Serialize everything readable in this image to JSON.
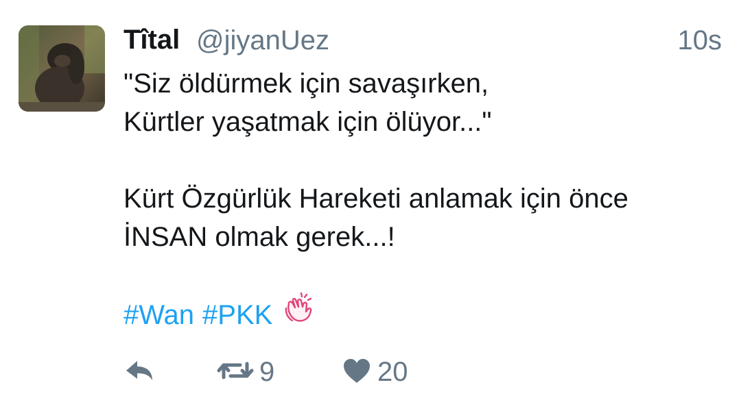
{
  "tweet": {
    "author_name": "Tîtal",
    "author_handle": "@jiyanUez",
    "timestamp": "10s",
    "text_lines": [
      "\"Siz öldürmek için savaşırken,",
      "Kürtler yaşatmak için ölüyor...\"",
      "Kürt Özgürlük Hareketi anlamak için önce",
      "İNSAN olmak gerek...!"
    ],
    "hashtags": [
      "#Wan",
      "#PKK"
    ],
    "emoji": "clapping-hands-icon"
  },
  "actions": {
    "reply_icon": "reply-icon",
    "retweet_icon": "retweet-icon",
    "retweet_count": "9",
    "like_icon": "heart-icon",
    "like_count": "20"
  },
  "colors": {
    "text": "#14171a",
    "secondary": "#657786",
    "link": "#1da1f2",
    "emoji_pink": "#e0457b"
  }
}
